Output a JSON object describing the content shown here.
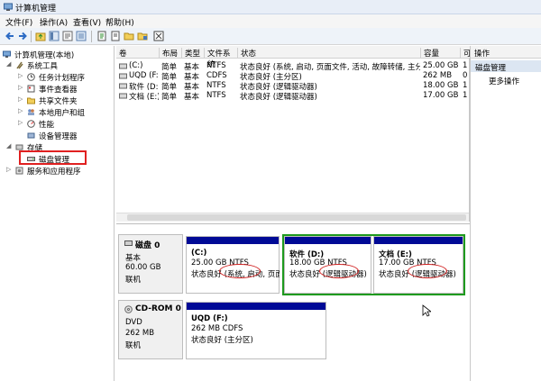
{
  "window": {
    "title": "计算机管理"
  },
  "menu": [
    "文件(F)",
    "操作(A)",
    "查看(V)",
    "帮助(H)"
  ],
  "tree": {
    "root": "计算机管理(本地)",
    "system_tools": "系统工具",
    "task_scheduler": "任务计划程序",
    "event_viewer": "事件查看器",
    "shared_folders": "共享文件夹",
    "local_users": "本地用户和组",
    "performance": "性能",
    "device_manager": "设备管理器",
    "storage": "存储",
    "disk_management": "磁盘管理",
    "services": "服务和应用程序"
  },
  "volume_list": {
    "headers": [
      "卷",
      "布局",
      "类型",
      "文件系统",
      "状态",
      "容量",
      "可"
    ],
    "rows": [
      [
        "(C:)",
        "简单",
        "基本",
        "NTFS",
        "状态良好 (系统, 启动, 页面文件, 活动, 故障转储, 主分区)",
        "25.00 GB",
        "1"
      ],
      [
        "UQD (F:)",
        "简单",
        "基本",
        "CDFS",
        "状态良好 (主分区)",
        "262 MB",
        "0"
      ],
      [
        "软件 (D:)",
        "简单",
        "基本",
        "NTFS",
        "状态良好 (逻辑驱动器)",
        "18.00 GB",
        "1"
      ],
      [
        "文档 (E:)",
        "简单",
        "基本",
        "NTFS",
        "状态良好 (逻辑驱动器)",
        "17.00 GB",
        "1"
      ]
    ]
  },
  "disk0": {
    "name": "磁盘 0",
    "type": "基本",
    "size": "60.00 GB",
    "status": "联机",
    "partitions": [
      {
        "name": "(C:)",
        "size": "25.00 GB NTFS",
        "status": "状态良好 (系统, 启动, 页面文"
      },
      {
        "name": "软件  (D:)",
        "size": "18.00 GB NTFS",
        "status": "状态良好 (逻辑驱动器)"
      },
      {
        "name": "文档  (E:)",
        "size": "17.00 GB NTFS",
        "status": "状态良好 (逻辑驱动器)"
      }
    ]
  },
  "cdrom0": {
    "name": "CD-ROM 0",
    "type": "DVD",
    "size": "262 MB",
    "status": "联机",
    "partition": {
      "name": "UQD  (F:)",
      "size": "262 MB CDFS",
      "status": "状态良好 (主分区)"
    }
  },
  "actions": {
    "header": "操作",
    "selected": "磁盘管理",
    "more": "更多操作"
  },
  "colors": {
    "partition_bar": "#000a96",
    "highlight_green": "#1e9a1e",
    "annotation_red": "#e02020"
  }
}
